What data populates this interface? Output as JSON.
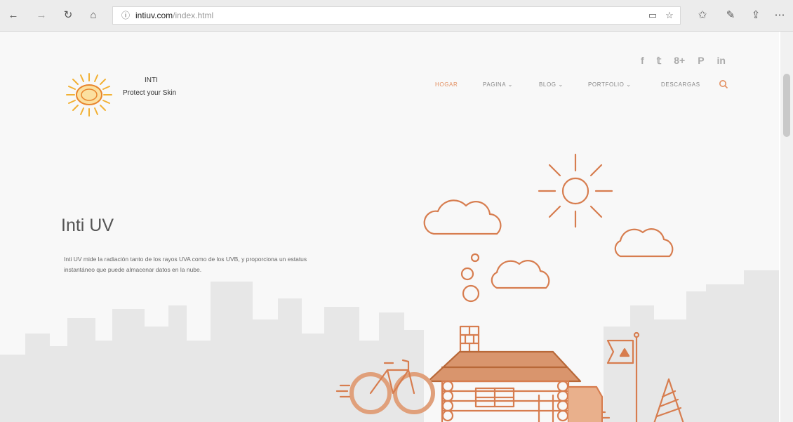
{
  "browser": {
    "host": "intiuv.com",
    "path": "/index.html",
    "icons": [
      "back-arrow",
      "forward-arrow",
      "refresh",
      "home",
      "info",
      "reading-view",
      "star",
      "favorites",
      "pen",
      "share",
      "more"
    ]
  },
  "site": {
    "social": [
      "f",
      "𝕥",
      "8+",
      "P",
      "in"
    ],
    "logo": {
      "name": "INTI",
      "tagline": "Protect your Skin"
    },
    "nav": [
      {
        "label": "HOGAR"
      },
      {
        "label": "PAGINA ⌄"
      },
      {
        "label": "BLOG ⌄"
      },
      {
        "label": "PORTFOLIO ⌄"
      },
      {
        "label": "DESCARGAS"
      }
    ],
    "hero": {
      "title": "Inti UV",
      "text": "Inti UV mide la radiación tanto de los rayos UVA como de los UVB, y proporciona un estatus instantáneo que puede almacenar datos en la nube."
    }
  },
  "colors": {
    "accent": "#e39062",
    "skyline": "#e7e7e7",
    "page_bg": "#f8f8f8"
  }
}
